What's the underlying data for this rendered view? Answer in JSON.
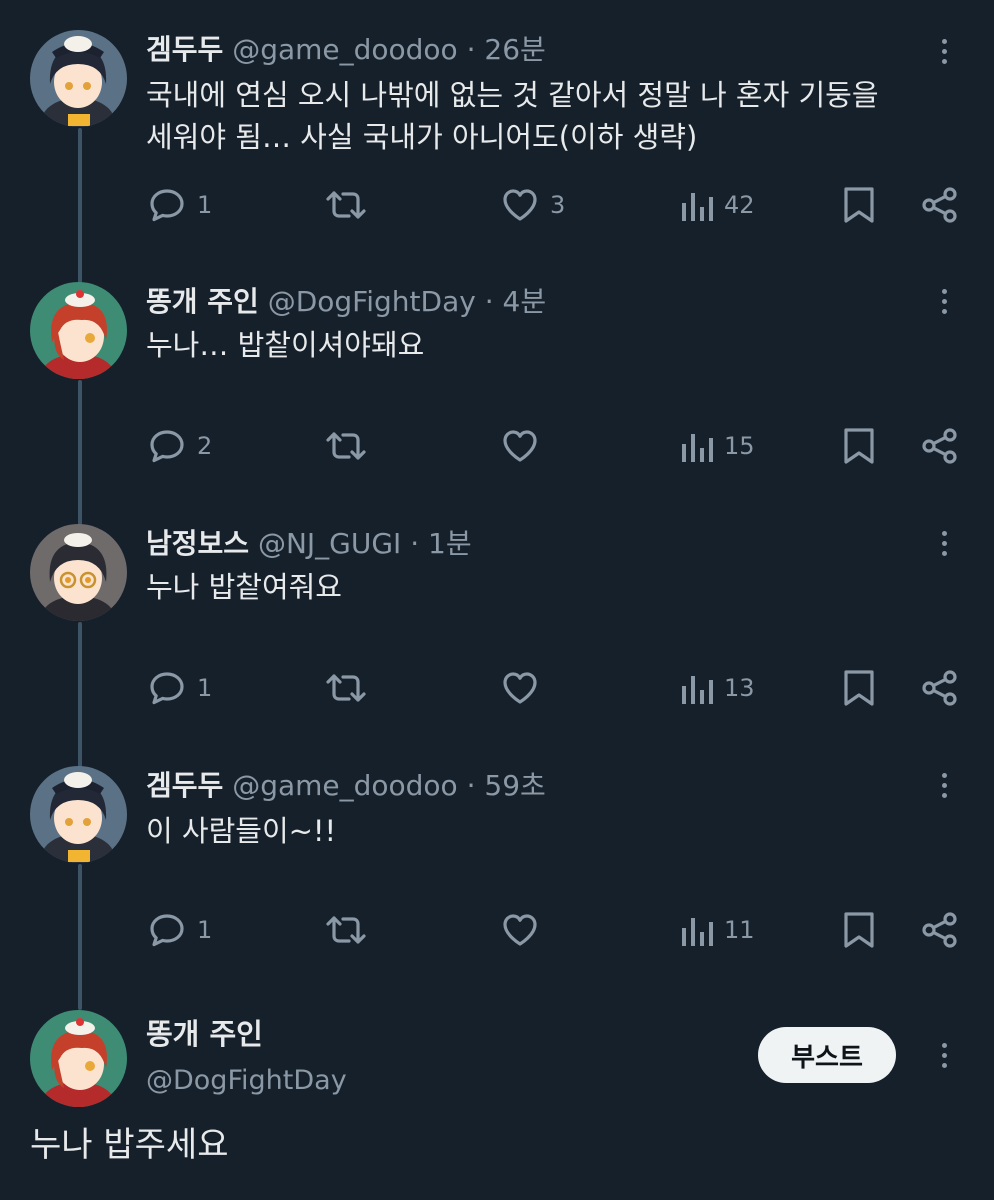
{
  "tweets": [
    {
      "name": "겜두두",
      "handle": "@game_doodoo",
      "time": "26분",
      "text_lines": [
        "국내에 연심 오시 나밖에 없는 것 같아서 정말 나 혼자 기둥을",
        "세워야 됨… 사실 국내가 아니어도(이하 생략)"
      ],
      "replies": "1",
      "retweets": "",
      "likes": "3",
      "views": "42"
    },
    {
      "name": "똥개 주인",
      "handle": "@DogFightDay",
      "time": "4분",
      "text_lines": [
        "누나… 밥챁이셔야돼요"
      ],
      "replies": "2",
      "retweets": "",
      "likes": "",
      "views": "15"
    },
    {
      "name": "남정보스",
      "handle": "@NJ_GUGI",
      "time": "1분",
      "text_lines": [
        "누나 밥챁여줘요"
      ],
      "replies": "1",
      "retweets": "",
      "likes": "",
      "views": "13"
    },
    {
      "name": "겜두두",
      "handle": "@game_doodoo",
      "time": "59초",
      "text_lines": [
        "이 사람들이~!!"
      ],
      "replies": "1",
      "retweets": "",
      "likes": "",
      "views": "11"
    }
  ],
  "main_tweet": {
    "name": "똥개 주인",
    "handle": "@DogFightDay",
    "boost_label": "부스트",
    "text": "누나 밥주세요"
  },
  "icons": {
    "reply": "speech-bubble-icon",
    "retweet": "retweet-arrows-icon",
    "like": "heart-icon",
    "views": "bar-chart-icon",
    "bookmark": "bookmark-icon",
    "share": "share-icon",
    "more": "vertical-dots-icon"
  },
  "colors": {
    "background": "#15202b",
    "text": "#e7e9ea",
    "muted": "#8b98a5",
    "thread_line": "#3d5466",
    "boost_bg": "#eff3f4"
  }
}
